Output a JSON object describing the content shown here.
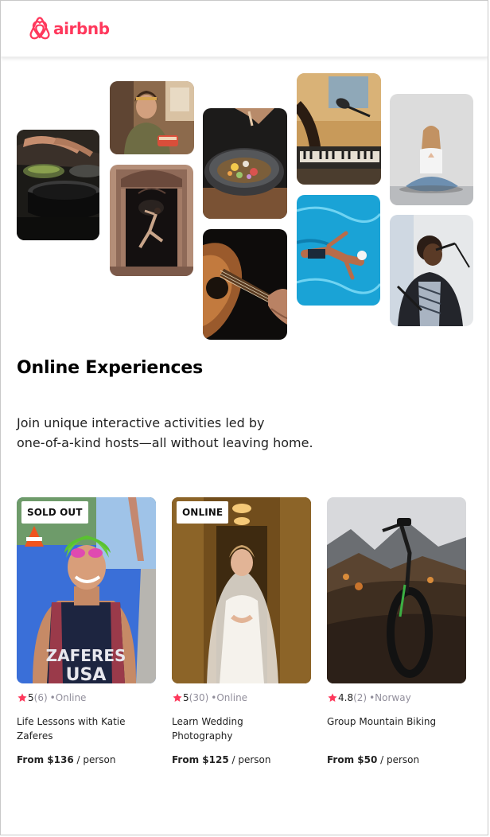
{
  "brand": {
    "name": "airbnb",
    "color": "#FF385C"
  },
  "hero": {
    "title": "Online Experiences",
    "subtitle_line1": "Join unique interactive activities led by",
    "subtitle_line2": "one-of-a-kind hosts—all without leaving home.",
    "photos": [
      {
        "name": "photo-cooking-pans",
        "subject": "cooking"
      },
      {
        "name": "photo-woman-chef",
        "subject": "chef holding food"
      },
      {
        "name": "photo-dancer-doorway",
        "subject": "dancer in ornate doorway"
      },
      {
        "name": "photo-food-bowl",
        "subject": "plated dish"
      },
      {
        "name": "photo-guitar",
        "subject": "acoustic guitar"
      },
      {
        "name": "photo-keyboard-mic",
        "subject": "keyboard and microphone"
      },
      {
        "name": "photo-swimmer",
        "subject": "swimmer in pool"
      },
      {
        "name": "photo-yoga",
        "subject": "woman meditating"
      },
      {
        "name": "photo-singer",
        "subject": "singer at microphone"
      }
    ]
  },
  "cards": [
    {
      "badge": "SOLD OUT",
      "rating": "5",
      "review_count": "(6)",
      "location": "•Online",
      "title": "Life Lessons with Katie Zaferes",
      "price_label": "From $136",
      "price_unit": " / person",
      "photo_subject": "athlete in swim cap",
      "jersey_text_1": "ZAFERES",
      "jersey_text_2": "USA"
    },
    {
      "badge": "ONLINE",
      "rating": "5",
      "review_count": "(30)",
      "location": "•Online",
      "title": "Learn Wedding Photography",
      "price_label": "From $125",
      "price_unit": " / person",
      "photo_subject": "bride in veil"
    },
    {
      "badge": "",
      "rating": "4.8",
      "review_count": "(2)",
      "location": "•Norway",
      "title": "Group Mountain Biking",
      "price_label": "From $50",
      "price_unit": " / person",
      "photo_subject": "mountain bike on hillside"
    }
  ],
  "colors": {
    "star": "#FE395C",
    "muted": "#918E9B",
    "text": "#222222"
  }
}
